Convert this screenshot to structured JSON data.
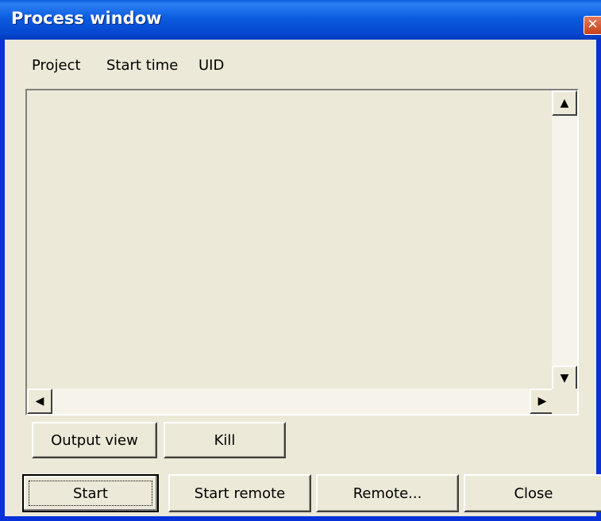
{
  "window": {
    "title": "Process window",
    "close_glyph": "✕"
  },
  "list": {
    "columns": [
      "Project",
      "Start time",
      "UID"
    ],
    "rows": []
  },
  "scroll": {
    "up_glyph": "▲",
    "down_glyph": "▼",
    "left_glyph": "◀",
    "right_glyph": "▶"
  },
  "actions": {
    "output_view": "Output view",
    "kill": "Kill"
  },
  "footer": {
    "start": "Start",
    "start_remote": "Start remote",
    "remote": "Remote...",
    "close": "Close"
  },
  "colors": {
    "face": "#ece9d8",
    "titlebar": "#0b5ce0",
    "close_button": "#c6411b"
  }
}
